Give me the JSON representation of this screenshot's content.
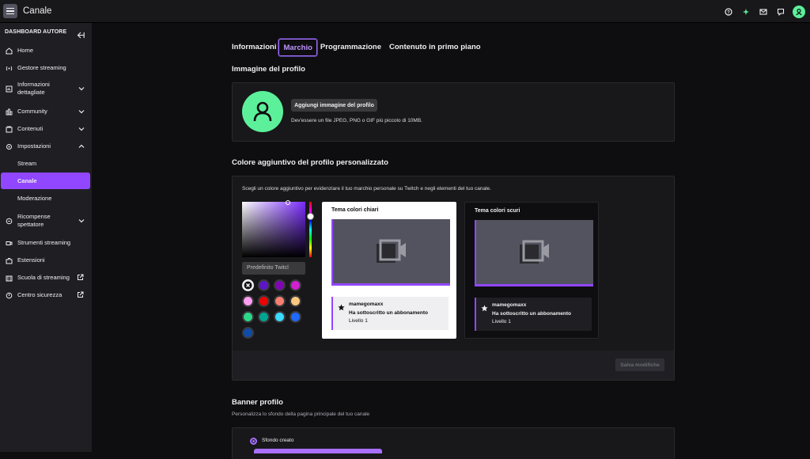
{
  "topbar": {
    "title": "Canale"
  },
  "sidebar": {
    "header": "DASHBOARD AUTORE",
    "items": [
      {
        "label": "Home",
        "icon": "home-icon"
      },
      {
        "label": "Gestore streaming",
        "icon": "broadcast-icon"
      },
      {
        "label": "Informazioni dettagliate",
        "icon": "insights-icon",
        "expandable": true
      },
      {
        "label": "Community",
        "icon": "community-icon",
        "expandable": true
      },
      {
        "label": "Contenuti",
        "icon": "content-icon",
        "expandable": true
      },
      {
        "label": "Impostazioni",
        "icon": "gear-icon",
        "expanded": true
      },
      {
        "label": "Stream"
      },
      {
        "label": "Canale",
        "active": true
      },
      {
        "label": "Moderazione"
      },
      {
        "label": "Ricompense spettatore",
        "icon": "rewards-icon",
        "expandable": true
      },
      {
        "label": "Strumenti streaming",
        "icon": "camera-icon"
      },
      {
        "label": "Estensioni",
        "icon": "extensions-icon"
      },
      {
        "label": "Scuola di streaming",
        "icon": "school-icon",
        "external": true
      },
      {
        "label": "Centro sicurezza",
        "icon": "shield-icon",
        "external": true
      }
    ]
  },
  "tabs": [
    "Informazioni",
    "Marchio",
    "Programmazione",
    "Contenuto in primo piano"
  ],
  "active_tab": "Marchio",
  "profile_image": {
    "title": "Immagine del profilo",
    "button": "Aggiungi immagine del profilo",
    "hint": "Dev'essere un file JPEG, PNG o GIF più piccolo di 10MB."
  },
  "accent": {
    "title": "Colore aggiuntivo del profilo personalizzato",
    "description": "Scegli un colore aggiuntivo per evidenziare il tuo marchio personale su Twitch e negli elementi del tuo canale.",
    "input_value": "Predefinito Twitcl",
    "swatches": [
      "#ffffff",
      "#5c16c5",
      "#8205b4",
      "#d120d2",
      "#ff9ef2",
      "#eb0400",
      "#f87e70",
      "#f9c87e",
      "#2bd988",
      "#00a591",
      "#39dafd",
      "#1f69ff",
      "#0f4ba8"
    ],
    "light_theme": {
      "title": "Tema colori chiari"
    },
    "dark_theme": {
      "title": "Tema colori scuri"
    },
    "chat": {
      "user": "mamegomaxx",
      "message": "Ha sottoscritto un abbonamento",
      "level": "Livello 1"
    },
    "save_button": "Salva modifiche",
    "colors": {
      "accent": "#9147ff"
    }
  },
  "banner": {
    "title": "Banner profilo",
    "subtitle": "Personalizza lo sfondo della pagina principale del tuo canale",
    "option": "Sfondo creato"
  }
}
